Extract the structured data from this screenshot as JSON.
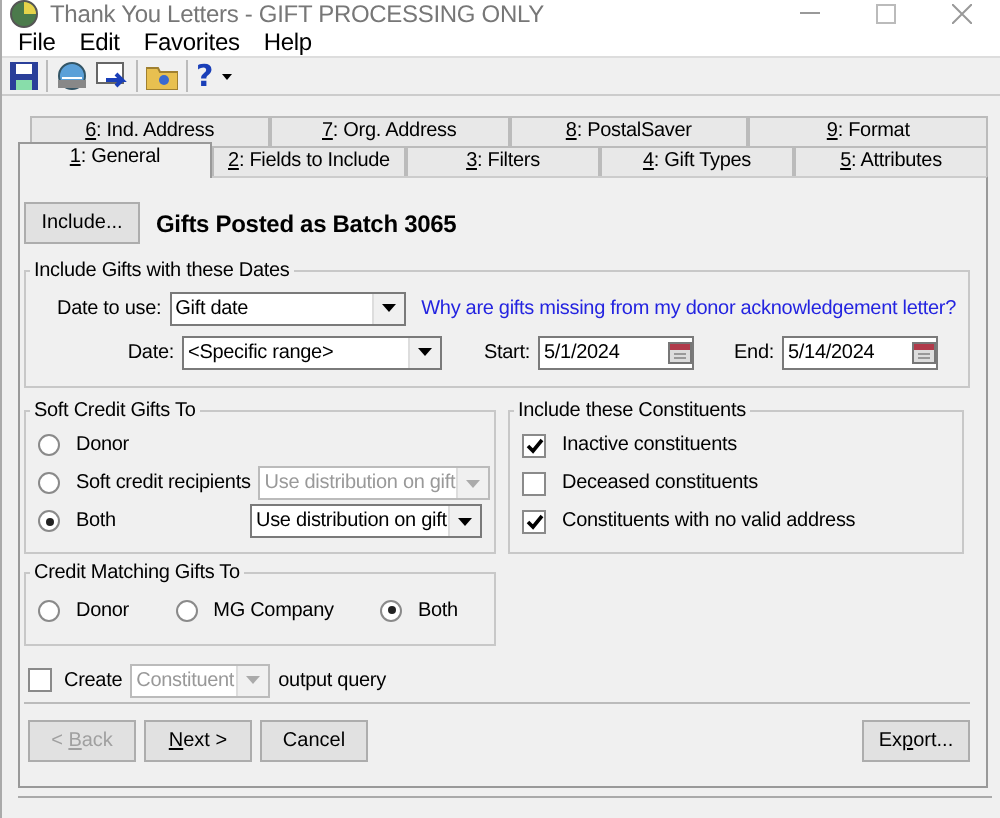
{
  "window": {
    "title": "Thank You Letters - GIFT PROCESSING ONLY"
  },
  "menu": [
    "File",
    "Edit",
    "Favorites",
    "Help"
  ],
  "toolbar": {
    "help_glyph": "?"
  },
  "tab_rows": [
    [
      {
        "key": "6",
        "label": ": Ind. Address",
        "selected": false
      },
      {
        "key": "7",
        "label": ": Org. Address",
        "selected": false
      },
      {
        "key": "8",
        "label": ": PostalSaver",
        "selected": false
      },
      {
        "key": "9",
        "label": ": Format",
        "selected": false
      }
    ],
    [
      {
        "key": "1",
        "label": ": General",
        "selected": true
      },
      {
        "key": "2",
        "label": ": Fields to Include",
        "selected": false
      },
      {
        "key": "3",
        "label": ": Filters",
        "selected": false
      },
      {
        "key": "4",
        "label": ": Gift Types",
        "selected": false
      },
      {
        "key": "5",
        "label": ": Attributes",
        "selected": false
      }
    ]
  ],
  "include_button": "Include...",
  "batch_title": "Gifts Posted as Batch 3065",
  "dates_group": {
    "title": "Include Gifts with these Dates",
    "date_to_use_label": "Date to use:",
    "date_to_use_value": "Gift date",
    "link": "Why are gifts missing from my donor acknowledgement letter?",
    "date_label": "Date:",
    "date_value": "<Specific range>",
    "start_label": "Start:",
    "start_value": "5/1/2024",
    "end_label": "End:",
    "end_value": "5/14/2024"
  },
  "soft_credit": {
    "title": "Soft Credit Gifts To",
    "options": [
      {
        "label": "Donor",
        "selected": false
      },
      {
        "label": "Soft credit recipients",
        "selected": false,
        "dropdown": {
          "value": "Use distribution on gift",
          "disabled": true
        }
      },
      {
        "label": "Both",
        "selected": true,
        "dropdown": {
          "value": "Use distribution on gift",
          "disabled": false
        }
      }
    ]
  },
  "constituents": {
    "title": "Include these Constituents",
    "items": [
      {
        "label": "Inactive constituents",
        "checked": true
      },
      {
        "label": "Deceased constituents",
        "checked": false
      },
      {
        "label": "Constituents with no valid address",
        "checked": true
      }
    ]
  },
  "matching": {
    "title": "Credit Matching Gifts To",
    "options": [
      {
        "label": "Donor",
        "selected": false
      },
      {
        "label": "MG Company",
        "selected": false
      },
      {
        "label": "Both",
        "selected": true
      }
    ]
  },
  "create": {
    "checked": false,
    "label": "Create",
    "dropdown": {
      "value": "Constituent",
      "disabled": true
    },
    "suffix": "output query"
  },
  "buttons": [
    {
      "before": "< ",
      "key": "B",
      "after": "ack",
      "disabled": true
    },
    {
      "key": "N",
      "after": "ext >",
      "disabled": false
    },
    {
      "before": "Cancel",
      "disabled": false
    },
    {
      "before": "Ex",
      "key": "p",
      "after": "ort...",
      "disabled": false
    }
  ]
}
